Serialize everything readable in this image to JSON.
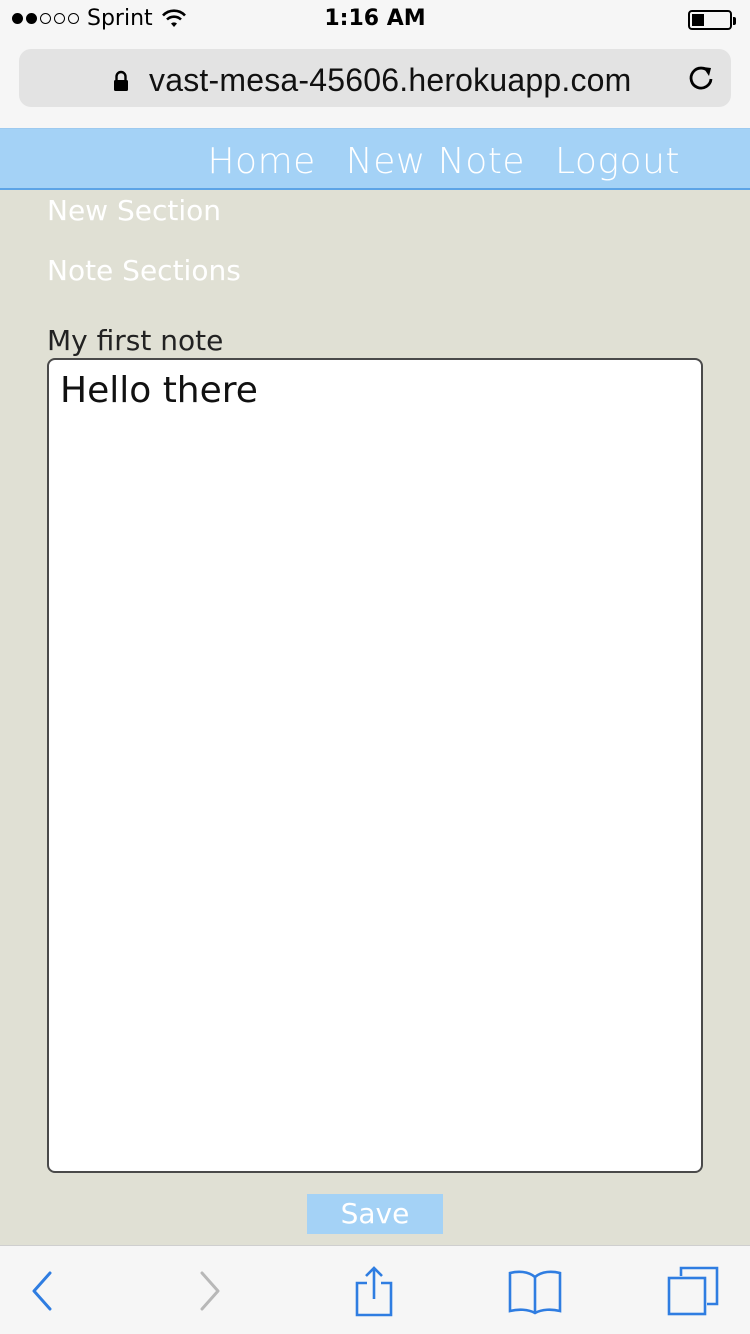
{
  "status_bar": {
    "carrier": "Sprint",
    "time": "1:16 AM",
    "signal_bars_filled": 2,
    "signal_bars_total": 5,
    "battery_level": 0.25
  },
  "browser": {
    "url": "vast-mesa-45606.herokuapp.com",
    "lock_icon": "lock-icon",
    "reload_icon": "reload-icon"
  },
  "nav": {
    "links": [
      "Home",
      "New Note",
      "Logout"
    ]
  },
  "sidebar": {
    "new_section": "New Section",
    "note_sections": "Note Sections"
  },
  "note": {
    "title": "My first note",
    "body": "Hello there"
  },
  "save_label": "Save",
  "toolbar": {
    "icons": [
      "back-icon",
      "forward-icon",
      "share-icon",
      "bookmarks-icon",
      "tabs-icon"
    ]
  },
  "colors": {
    "nav_bg": "#a4d2f6",
    "accent_blue": "#2f7de1",
    "page_bg": "#e0e0d4"
  }
}
